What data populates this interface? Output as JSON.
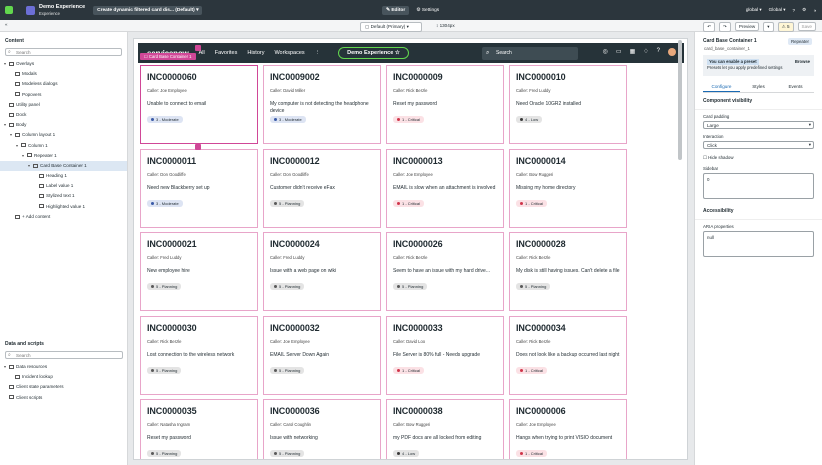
{
  "topbar": {
    "app_title": "Demo Experience",
    "app_subtitle": "Experience",
    "page_selector": "Create dynamic filtered card dis... (Default) ▾",
    "mode_editor": "✎ Editor",
    "mode_settings": "⚙ Settings",
    "global_scope": "global ▾",
    "global_lang": "Global ▾"
  },
  "subbar": {
    "device": "▢ Default (Primary) ▾",
    "width": "↕ 1304px",
    "preview": "Preview",
    "preview_caret": "▾",
    "warnings": "⚠ 5",
    "save": "Save"
  },
  "left_panel": {
    "content_heading": "Content",
    "search_placeholder": "Search",
    "tree": [
      {
        "label": "Overlays",
        "toggle": "▾"
      },
      {
        "label": "Modals",
        "toggle": ""
      },
      {
        "label": "Modeless dialogs",
        "toggle": ""
      },
      {
        "label": "Popovers",
        "toggle": ""
      },
      {
        "label": "Utility panel",
        "toggle": ""
      },
      {
        "label": "Dock",
        "toggle": ""
      },
      {
        "label": "Body",
        "toggle": "▾"
      },
      {
        "label": "Column layout 1",
        "toggle": "▾"
      },
      {
        "label": "Column 1",
        "toggle": "▾"
      },
      {
        "label": "Repeater 1",
        "toggle": "▾"
      },
      {
        "label": "Card Base Container 1",
        "toggle": "▾"
      },
      {
        "label": "Heading 1",
        "toggle": ""
      },
      {
        "label": "Label value 1",
        "toggle": ""
      },
      {
        "label": "Stylized text 1",
        "toggle": ""
      },
      {
        "label": "Highlighted value 1",
        "toggle": ""
      },
      {
        "label": "+ Add content",
        "toggle": ""
      }
    ],
    "data_heading": "Data and scripts",
    "data_search": "Search",
    "data_tree": [
      {
        "label": "Data resources",
        "toggle": "▾"
      },
      {
        "label": "Incident lookup",
        "toggle": ""
      },
      {
        "label": "Client state parameters",
        "toggle": ""
      },
      {
        "label": "Client scripts",
        "toggle": ""
      }
    ]
  },
  "nav": {
    "logo": "servicenow",
    "links": [
      "All",
      "Favorites",
      "History",
      "Workspaces",
      "⋮"
    ],
    "experience": "Demo Experience ☆",
    "search_placeholder": "Search"
  },
  "selection": {
    "label": "☐ Card Base Container 1"
  },
  "caller_prefix": "Caller: ",
  "cards": [
    {
      "number": "INC0000060",
      "caller": "Joe Employee",
      "desc": "Unable to connect to email",
      "priority": "3 - Moderate",
      "color": "#3b5ba8"
    },
    {
      "number": "INC0009002",
      "caller": "David Miller",
      "desc": "My computer is not detecting the headphone device",
      "priority": "3 - Moderate",
      "color": "#3b5ba8"
    },
    {
      "number": "INC0000009",
      "caller": "Rick Berzle",
      "desc": "Reset my password",
      "priority": "1 - Critical",
      "color": "#d0364b"
    },
    {
      "number": "INC0000010",
      "caller": "Fred Luddy",
      "desc": "Need Oracle 10GR2 installed",
      "priority": "4 - Low",
      "color": "#3a3a3a"
    },
    {
      "number": "INC0000011",
      "caller": "Don Goodliffe",
      "desc": "Need new Blackberry set up",
      "priority": "3 - Moderate",
      "color": "#3b5ba8"
    },
    {
      "number": "INC0000012",
      "caller": "Don Goodliffe",
      "desc": "Customer didn't receive eFax",
      "priority": "5 - Planning",
      "color": "#5a5a5a"
    },
    {
      "number": "INC0000013",
      "caller": "Joe Employee",
      "desc": "EMAIL is slow when an attachment is involved",
      "priority": "1 - Critical",
      "color": "#d0364b"
    },
    {
      "number": "INC0000014",
      "caller": "Bow Ruggeri",
      "desc": "Missing my home directory",
      "priority": "1 - Critical",
      "color": "#d0364b"
    },
    {
      "number": "INC0000021",
      "caller": "Fred Luddy",
      "desc": "New employee hire",
      "priority": "5 - Planning",
      "color": "#5a5a5a"
    },
    {
      "number": "INC0000024",
      "caller": "Fred Luddy",
      "desc": "Issue with a web page on wiki",
      "priority": "5 - Planning",
      "color": "#5a5a5a"
    },
    {
      "number": "INC0000026",
      "caller": "Rick Berzle",
      "desc": "Seem to have an issue with my hard drive...",
      "priority": "5 - Planning",
      "color": "#5a5a5a"
    },
    {
      "number": "INC0000028",
      "caller": "Rick Berzle",
      "desc": "My disk is still having issues. Can't delete a file",
      "priority": "5 - Planning",
      "color": "#5a5a5a"
    },
    {
      "number": "INC0000030",
      "caller": "Rick Berzle",
      "desc": "Lost connection to the wireless network",
      "priority": "5 - Planning",
      "color": "#5a5a5a"
    },
    {
      "number": "INC0000032",
      "caller": "Joe Employee",
      "desc": "EMAIL Server Down Again",
      "priority": "5 - Planning",
      "color": "#5a5a5a"
    },
    {
      "number": "INC0000033",
      "caller": "David Loo",
      "desc": "File Server is 80% full - Needs upgrade",
      "priority": "1 - Critical",
      "color": "#d0364b"
    },
    {
      "number": "INC0000034",
      "caller": "Rick Berzle",
      "desc": "Does not look like a backup occurred last night",
      "priority": "1 - Critical",
      "color": "#d0364b"
    },
    {
      "number": "INC0000035",
      "caller": "Natasha Ingram",
      "desc": "Reset my password",
      "priority": "5 - Planning",
      "color": "#5a5a5a"
    },
    {
      "number": "INC0000036",
      "caller": "Carol Coughlin",
      "desc": "Issue with networking",
      "priority": "5 - Planning",
      "color": "#5a5a5a"
    },
    {
      "number": "INC0000038",
      "caller": "Bow Ruggeri",
      "desc": "my PDF docs are all locked from editing",
      "priority": "4 - Low",
      "color": "#3a3a3a"
    },
    {
      "number": "INC0000006",
      "caller": "Joe Employee",
      "desc": "Hangs when trying to print VISIO document",
      "priority": "1 - Critical",
      "color": "#d0364b"
    }
  ],
  "right_panel": {
    "title": "Card Base Container 1",
    "tag": "Repeater",
    "subtitle": "card_base_container_1",
    "preset_highlight": "You can enable a preset",
    "preset_rest": "Presets let you apply predefined settings",
    "browse": "Browse",
    "tabs": [
      "Configure",
      "Styles",
      "Events"
    ],
    "visibility_heading": "Component visibility",
    "card_padding_label": "Card padding",
    "card_padding_value": "Large",
    "interaction_label": "Interaction",
    "interaction_value": "Click",
    "hide_shadow": "Hide shadow",
    "sidebar_label": "Sidebar",
    "sidebar_value": "0",
    "accessibility_heading": "Accessibility",
    "aria_label": "ARIA properties",
    "aria_value": "null"
  },
  "colors": {
    "topbar": "#2c363d",
    "accent_pink": "#d04797",
    "nav": "#263339",
    "green": "#62d84e"
  }
}
